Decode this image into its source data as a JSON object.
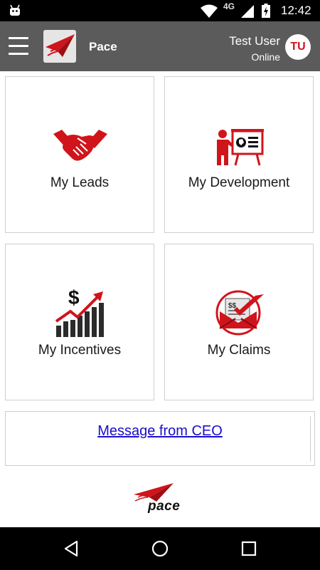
{
  "status_bar": {
    "network_label": "4G",
    "time": "12:42"
  },
  "app_bar": {
    "title": "Pace",
    "user_name": "Test User",
    "user_status": "Online",
    "avatar_initials": "TU"
  },
  "tiles": [
    {
      "label": "My Leads",
      "icon": "handshake-icon"
    },
    {
      "label": "My Development",
      "icon": "presentation-icon"
    },
    {
      "label": "My Incentives",
      "icon": "growth-chart-icon"
    },
    {
      "label": "My Claims",
      "icon": "claims-envelope-icon"
    }
  ],
  "ceo_message": {
    "link_text": "Message from CEO"
  },
  "footer": {
    "brand_word": "pace"
  },
  "colors": {
    "brand_red": "#d0141b",
    "app_bar": "#5b5b5b",
    "link": "#1a0dcc"
  }
}
